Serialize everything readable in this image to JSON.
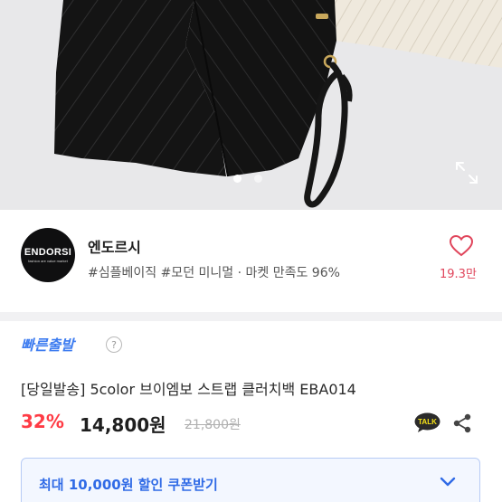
{
  "product_image": {
    "alt": "black and ivory chevron quilted clutch bags",
    "slide_indicator": {
      "current": 1,
      "total": 2
    },
    "icons": {
      "expand": "expand-icon"
    }
  },
  "store": {
    "logo_name": "ENDORSI",
    "logo_tagline": "fashion are value market",
    "name": "엔도르시",
    "tags": "#심플베이직 #모던 미니멀 · 마켓 만족도 96%",
    "likes": "19.3만",
    "icons": {
      "like": "heart-icon"
    }
  },
  "product": {
    "fast_shipping": "빠른출발",
    "info_glyph": "?",
    "title": "[당일발송] 5color 브이엠보 스트랩 클러치백 EBA014",
    "discount": "32%",
    "price": "14,800원",
    "original_price": "21,800원",
    "icons": {
      "talk": "kakaotalk-icon",
      "share": "share-icon"
    },
    "talk_label": "TALK"
  },
  "coupon": {
    "label": "최대 10,000원 할인 쿠폰받기",
    "icon": "chevron-down-icon"
  },
  "colors": {
    "accent_blue": "#3d7cf0",
    "discount_red": "#ff3b45",
    "like_pink": "#e0455b",
    "coupon_bg": "#f3f7ff"
  }
}
